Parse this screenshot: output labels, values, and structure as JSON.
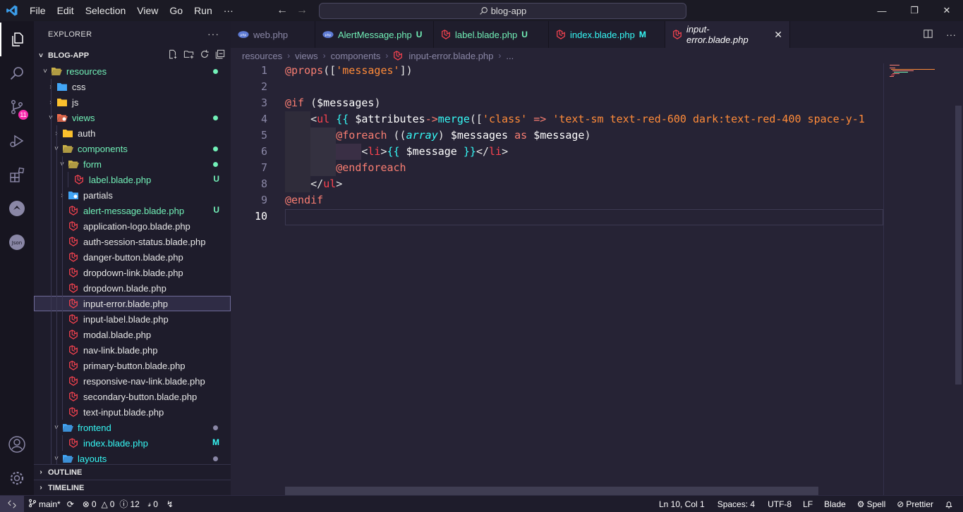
{
  "titlebar": {
    "menu": [
      "File",
      "Edit",
      "Selection",
      "View",
      "Go",
      "Run",
      "···"
    ],
    "search": "blog-app",
    "back_icon": "arrow-left-icon",
    "forward_icon": "arrow-right-icon"
  },
  "activity": {
    "badge": "11"
  },
  "sidebar": {
    "title": "EXPLORER",
    "more": "···",
    "project": "BLOG-APP",
    "tree": [
      {
        "label": "resources",
        "depth": 1,
        "type": "folder-open",
        "twisty": "˅",
        "dot": "#72f1b8",
        "color": "#72f1b8"
      },
      {
        "label": "css",
        "depth": 2,
        "type": "folder-css",
        "twisty": "›"
      },
      {
        "label": "js",
        "depth": 2,
        "type": "folder-js",
        "twisty": "›"
      },
      {
        "label": "views",
        "depth": 2,
        "type": "folder-views",
        "twisty": "˅",
        "dot": "#72f1b8",
        "color": "#72f1b8"
      },
      {
        "label": "auth",
        "depth": 3,
        "type": "folder",
        "twisty": "›"
      },
      {
        "label": "components",
        "depth": 3,
        "type": "folder-open",
        "twisty": "˅",
        "dot": "#72f1b8",
        "color": "#72f1b8"
      },
      {
        "label": "form",
        "depth": 4,
        "type": "folder-open",
        "twisty": "˅",
        "dot": "#72f1b8",
        "color": "#72f1b8"
      },
      {
        "label": "label.blade.php",
        "depth": 5,
        "type": "blade",
        "status": "U",
        "color": "#72f1b8"
      },
      {
        "label": "partials",
        "depth": 4,
        "type": "folder-partials",
        "twisty": "›"
      },
      {
        "label": "alert-message.blade.php",
        "depth": 4,
        "type": "blade",
        "status": "U",
        "color": "#72f1b8"
      },
      {
        "label": "application-logo.blade.php",
        "depth": 4,
        "type": "blade"
      },
      {
        "label": "auth-session-status.blade.php",
        "depth": 4,
        "type": "blade"
      },
      {
        "label": "danger-button.blade.php",
        "depth": 4,
        "type": "blade"
      },
      {
        "label": "dropdown-link.blade.php",
        "depth": 4,
        "type": "blade"
      },
      {
        "label": "dropdown.blade.php",
        "depth": 4,
        "type": "blade"
      },
      {
        "label": "input-error.blade.php",
        "depth": 4,
        "type": "blade",
        "selected": true
      },
      {
        "label": "input-label.blade.php",
        "depth": 4,
        "type": "blade"
      },
      {
        "label": "modal.blade.php",
        "depth": 4,
        "type": "blade"
      },
      {
        "label": "nav-link.blade.php",
        "depth": 4,
        "type": "blade"
      },
      {
        "label": "primary-button.blade.php",
        "depth": 4,
        "type": "blade"
      },
      {
        "label": "responsive-nav-link.blade.php",
        "depth": 4,
        "type": "blade"
      },
      {
        "label": "secondary-button.blade.php",
        "depth": 4,
        "type": "blade"
      },
      {
        "label": "text-input.blade.php",
        "depth": 4,
        "type": "blade"
      },
      {
        "label": "frontend",
        "depth": 3,
        "type": "folder-frontend",
        "twisty": "˅",
        "dot": "#8a87a6",
        "color": "#36f9f6"
      },
      {
        "label": "index.blade.php",
        "depth": 4,
        "type": "blade",
        "status": "M",
        "color": "#36f9f6"
      },
      {
        "label": "layouts",
        "depth": 3,
        "type": "folder-layouts",
        "twisty": "˅",
        "dot": "#8a87a6",
        "color": "#36f9f6"
      }
    ],
    "sections": [
      "OUTLINE",
      "TIMELINE"
    ]
  },
  "tabs": [
    {
      "label": "web.php",
      "icon": "php",
      "mark": "",
      "color": "#8a87a6"
    },
    {
      "label": "AlertMessage.php",
      "icon": "php",
      "mark": "U",
      "color": "#72f1b8"
    },
    {
      "label": "label.blade.php",
      "icon": "blade",
      "mark": "U",
      "color": "#72f1b8"
    },
    {
      "label": "index.blade.php",
      "icon": "blade",
      "mark": "M",
      "color": "#36f9f6"
    },
    {
      "label": "input-error.blade.php",
      "icon": "blade",
      "mark": "",
      "color": "#ffffff",
      "active": true
    }
  ],
  "breadcrumb": [
    "resources",
    "views",
    "components",
    "input-error.blade.php",
    "..."
  ],
  "editor": {
    "line_numbers": [
      "1",
      "2",
      "3",
      "4",
      "5",
      "6",
      "7",
      "8",
      "9",
      "10"
    ],
    "current_line": "10",
    "lines": [
      [
        {
          "t": "@props",
          "c": "t-dir"
        },
        {
          "t": "([",
          "c": ""
        },
        {
          "t": "'messages'",
          "c": "t-str"
        },
        {
          "t": "])",
          "c": ""
        }
      ],
      [],
      [
        {
          "t": "@if",
          "c": "t-dir"
        },
        {
          "t": " (",
          "c": ""
        },
        {
          "t": "$messages",
          "c": "t-var"
        },
        {
          "t": ")",
          "c": ""
        }
      ],
      [
        {
          "t": "    ",
          "c": ""
        },
        {
          "t": "<",
          "c": ""
        },
        {
          "t": "ul",
          "c": "t-blade"
        },
        {
          "t": " ",
          "c": ""
        },
        {
          "t": "{{",
          "c": "t-brace"
        },
        {
          "t": " $attributes",
          "c": "t-var"
        },
        {
          "t": "->",
          "c": "t-dir"
        },
        {
          "t": "merge",
          "c": "t-fn"
        },
        {
          "t": "([",
          "c": ""
        },
        {
          "t": "'class'",
          "c": "t-str"
        },
        {
          "t": " => ",
          "c": "t-dir"
        },
        {
          "t": "'text-sm text-red-600 dark:text-red-400 space-y-1",
          "c": "t-str"
        }
      ],
      [
        {
          "t": "        ",
          "c": ""
        },
        {
          "t": "@foreach",
          "c": "t-dir"
        },
        {
          "t": " ((",
          "c": ""
        },
        {
          "t": "array",
          "c": "t-ital"
        },
        {
          "t": ") ",
          "c": ""
        },
        {
          "t": "$messages",
          "c": "t-var"
        },
        {
          "t": " as ",
          "c": "t-dir"
        },
        {
          "t": "$message",
          "c": "t-var"
        },
        {
          "t": ")",
          "c": ""
        }
      ],
      [
        {
          "t": "            ",
          "c": ""
        },
        {
          "t": "<",
          "c": ""
        },
        {
          "t": "li",
          "c": "t-blade"
        },
        {
          "t": ">",
          "c": ""
        },
        {
          "t": "{{",
          "c": "t-brace"
        },
        {
          "t": " $message ",
          "c": "t-var"
        },
        {
          "t": "}}",
          "c": "t-brace"
        },
        {
          "t": "</",
          "c": ""
        },
        {
          "t": "li",
          "c": "t-blade"
        },
        {
          "t": ">",
          "c": ""
        }
      ],
      [
        {
          "t": "        ",
          "c": ""
        },
        {
          "t": "@endforeach",
          "c": "t-dir"
        }
      ],
      [
        {
          "t": "    ",
          "c": ""
        },
        {
          "t": "</",
          "c": ""
        },
        {
          "t": "ul",
          "c": "t-blade"
        },
        {
          "t": ">",
          "c": ""
        }
      ],
      [
        {
          "t": "@endif",
          "c": "t-dir"
        }
      ],
      []
    ]
  },
  "statusbar": {
    "branch": "main*",
    "errors": "0",
    "warnings": "0",
    "info": "12",
    "ports": "0",
    "position": "Ln 10, Col 1",
    "spaces": "Spaces: 4",
    "encoding": "UTF-8",
    "eol": "LF",
    "language": "Blade",
    "spell": "Spell",
    "prettier": "Prettier"
  }
}
